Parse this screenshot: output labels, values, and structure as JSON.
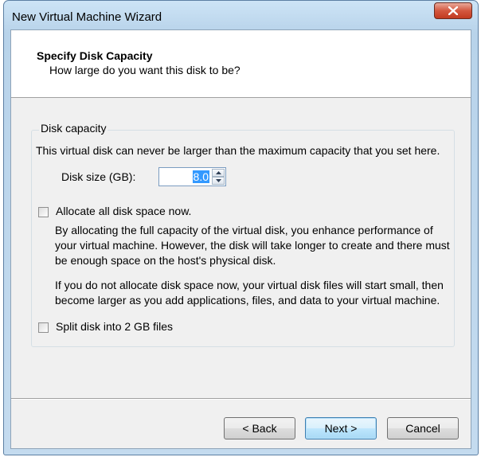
{
  "window": {
    "title": "New Virtual Machine Wizard"
  },
  "header": {
    "title": "Specify Disk Capacity",
    "subtitle": "How large do you want this disk to be?"
  },
  "disk_capacity": {
    "group_label": "Disk capacity",
    "description": "This virtual disk can never be larger than the maximum capacity that you set here.",
    "size_label": "Disk size (GB):",
    "size_value": "8.0"
  },
  "allocate": {
    "label": "Allocate all disk space now.",
    "checked": false,
    "paragraph1": [
      "By allocating the full capacity of the virtual disk, you enhance performance of",
      "your virtual machine.  However, the disk will take longer to create and there must",
      "be enough space on the host's physical disk."
    ],
    "paragraph2": [
      "If you do not allocate disk space now, your virtual disk files will start small, then",
      "become larger as you add applications, files, and data to your virtual machine."
    ]
  },
  "split": {
    "label": "Split disk into 2 GB files",
    "checked": false
  },
  "buttons": {
    "back": "< Back",
    "next": "Next >",
    "cancel": "Cancel"
  }
}
